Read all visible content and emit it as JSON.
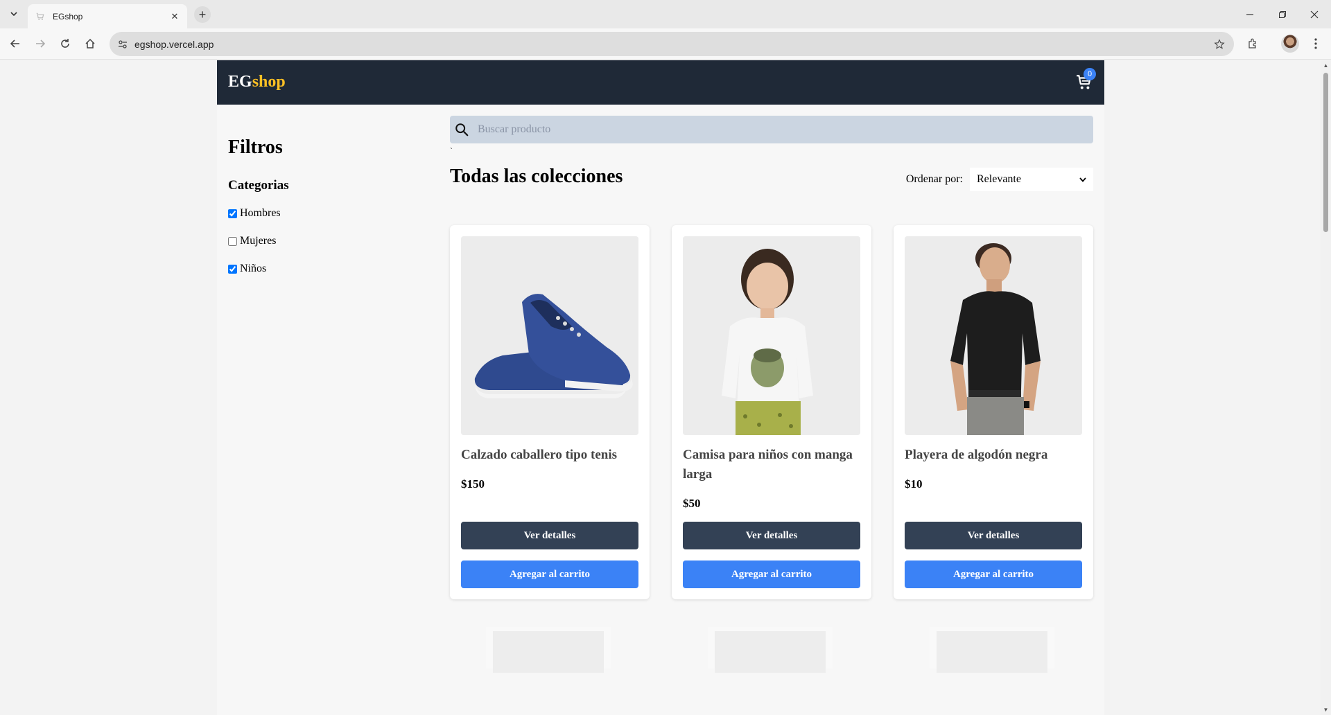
{
  "browser": {
    "tab_title": "EGshop",
    "url": "egshop.vercel.app"
  },
  "site": {
    "logo_part1": "EG",
    "logo_part2": "shop",
    "cart_count": "0",
    "colors": {
      "header": "#1f2937",
      "accent": "#fbbf24",
      "primary": "#3b82f6",
      "dark_button": "#334155"
    }
  },
  "filters": {
    "title": "Filtros",
    "categories_title": "Categorias",
    "categories": [
      {
        "label": "Hombres",
        "checked": true
      },
      {
        "label": "Mujeres",
        "checked": false
      },
      {
        "label": "Niños",
        "checked": true
      }
    ]
  },
  "search": {
    "placeholder": "Buscar producto",
    "stray_char": "`"
  },
  "collection": {
    "title": "Todas las colecciones",
    "sort_label": "Ordenar por:",
    "sort_value": "Relevante"
  },
  "products": [
    {
      "name": "Calzado caballero tipo tenis",
      "price": "$150",
      "details_label": "Ver detalles",
      "add_label": "Agregar al carrito",
      "image": "blue-sneakers"
    },
    {
      "name": "Camisa para niños con manga larga",
      "price": "$50",
      "details_label": "Ver detalles",
      "add_label": "Agregar al carrito",
      "image": "boy-white-shirt"
    },
    {
      "name": "Playera de algodón negra",
      "price": "$10",
      "details_label": "Ver detalles",
      "add_label": "Agregar al carrito",
      "image": "man-black-tshirt"
    }
  ]
}
